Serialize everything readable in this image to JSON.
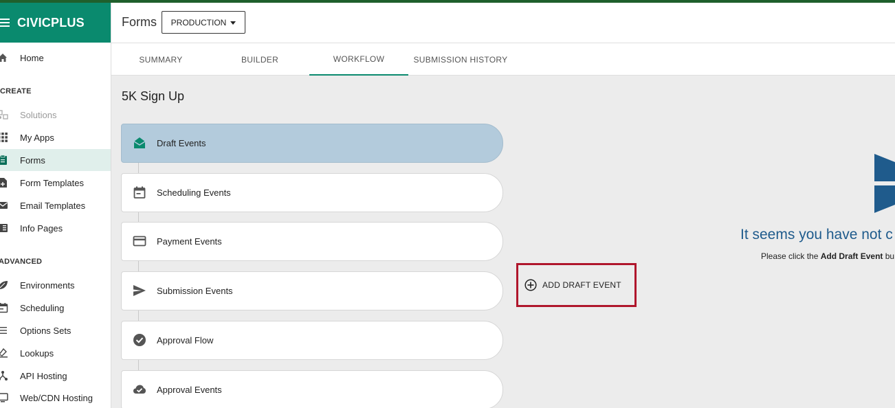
{
  "brand": {
    "name": "CIVICPLUS"
  },
  "sidebar": {
    "home": "Home",
    "section_create": "CREATE",
    "items_create": [
      {
        "label": "Solutions",
        "icon": "solutions-icon"
      },
      {
        "label": "My Apps",
        "icon": "grid-icon"
      },
      {
        "label": "Forms",
        "icon": "clipboard-icon"
      },
      {
        "label": "Form Templates",
        "icon": "file-plus-icon"
      },
      {
        "label": "Email Templates",
        "icon": "mail-icon"
      },
      {
        "label": "Info Pages",
        "icon": "book-icon"
      }
    ],
    "section_advanced": "ADVANCED",
    "items_advanced": [
      {
        "label": "Environments",
        "icon": "leaf-icon"
      },
      {
        "label": "Scheduling",
        "icon": "calendar-icon"
      },
      {
        "label": "Options Sets",
        "icon": "list-icon"
      },
      {
        "label": "Lookups",
        "icon": "lookup-icon"
      },
      {
        "label": "API Hosting",
        "icon": "api-icon"
      },
      {
        "label": "Web/CDN Hosting",
        "icon": "monitor-icon"
      }
    ]
  },
  "header": {
    "title": "Forms",
    "environment": "PRODUCTION"
  },
  "tabs": [
    {
      "label": "SUMMARY"
    },
    {
      "label": "BUILDER"
    },
    {
      "label": "WORKFLOW"
    },
    {
      "label": "SUBMISSION HISTORY"
    }
  ],
  "main": {
    "form_title": "5K Sign Up",
    "events": [
      {
        "label": "Draft Events",
        "icon": "envelope-open-icon"
      },
      {
        "label": "Scheduling Events",
        "icon": "calendar-icon"
      },
      {
        "label": "Payment Events",
        "icon": "credit-card-icon"
      },
      {
        "label": "Submission Events",
        "icon": "send-icon"
      },
      {
        "label": "Approval Flow",
        "icon": "check-circle-icon"
      },
      {
        "label": "Approval Events",
        "icon": "cloud-check-icon"
      }
    ],
    "add_button": "ADD DRAFT EVENT",
    "empty_heading": "It seems you have not c",
    "empty_sub_prefix": "Please click the ",
    "empty_sub_bold": "Add Draft Event",
    "empty_sub_suffix": " bu"
  },
  "colors": {
    "brand": "#0a8a6e",
    "selected_event": "#b3cbdc",
    "highlight_border": "#b0162c",
    "empty_heading": "#1f5b8c"
  }
}
